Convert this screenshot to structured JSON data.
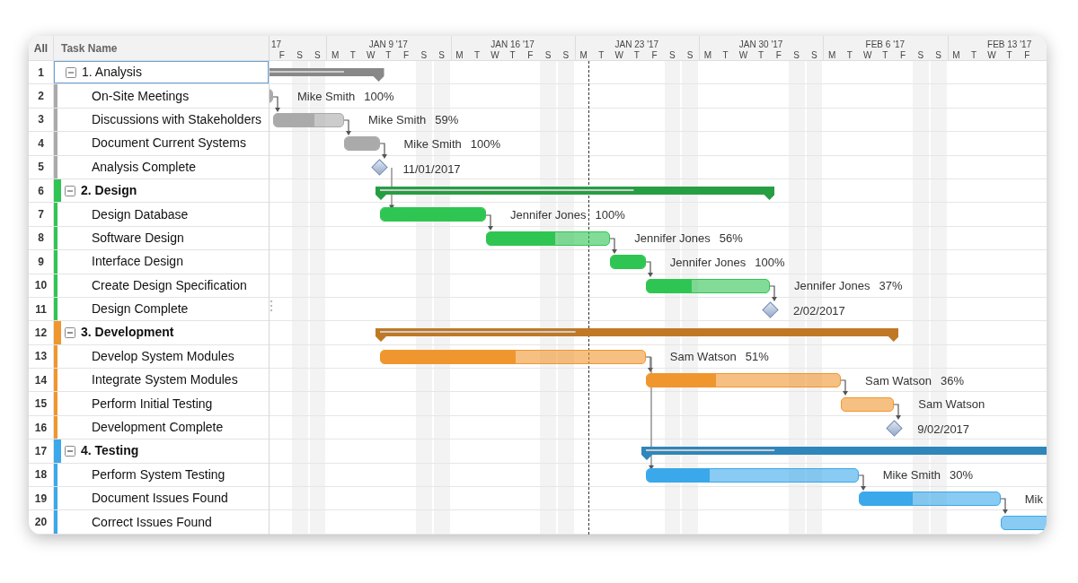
{
  "header": {
    "all_label": "All",
    "name_label": "Task Name"
  },
  "timeline": {
    "weeks": [
      {
        "label": "17",
        "days": [
          "F",
          "S",
          "S"
        ]
      },
      {
        "label": "JAN 9 '17",
        "days": [
          "M",
          "T",
          "W",
          "T",
          "F",
          "S",
          "S"
        ]
      },
      {
        "label": "JAN 16 '17",
        "days": [
          "M",
          "T",
          "W",
          "T",
          "F",
          "S",
          "S"
        ]
      },
      {
        "label": "JAN 23 '17",
        "days": [
          "M",
          "T",
          "W",
          "T",
          "F",
          "S",
          "S"
        ]
      },
      {
        "label": "JAN 30 '17",
        "days": [
          "M",
          "T",
          "W",
          "T",
          "F",
          "S",
          "S"
        ]
      },
      {
        "label": "FEB 6 '17",
        "days": [
          "M",
          "T",
          "W",
          "T",
          "F",
          "S",
          "S"
        ]
      },
      {
        "label": "FEB 13 '17",
        "days": [
          "M",
          "T",
          "W",
          "T",
          "F"
        ]
      }
    ]
  },
  "groups": [
    {
      "number": "1",
      "name": "1. Analysis",
      "color": "#aaaaaa",
      "expanded": true,
      "selected": true,
      "level": 0.8,
      "children": [
        {
          "number": "2",
          "name": "On-Site Meetings",
          "kind": "task",
          "level": 1,
          "resource": "Mike Smith",
          "percent": "100%"
        },
        {
          "number": "3",
          "name": "Discussions with Stakeholders",
          "kind": "task",
          "level": 0.59,
          "resource": "Mike Smith",
          "percent": "59%"
        },
        {
          "number": "4",
          "name": "Document Current Systems",
          "kind": "task",
          "level": 1,
          "resource": "Mike Smith",
          "percent": "100%"
        },
        {
          "number": "5",
          "name": "Analysis Complete",
          "kind": "milestone",
          "label": "11/01/2017",
          "link_to_next_group": true
        }
      ]
    },
    {
      "number": "6",
      "name": "2. Design",
      "color": "#2fc552",
      "expanded": true,
      "selected": false,
      "level": 0.65,
      "children": [
        {
          "number": "7",
          "name": "Design Database",
          "kind": "task",
          "level": 1,
          "resource": "Jennifer Jones",
          "percent": "100%"
        },
        {
          "number": "8",
          "name": "Software Design",
          "kind": "task",
          "level": 0.56,
          "resource": "Jennifer Jones",
          "percent": "56%"
        },
        {
          "number": "9",
          "name": "Interface Design",
          "kind": "task",
          "level": 1,
          "resource": "Jennifer Jones",
          "percent": "100%"
        },
        {
          "number": "10",
          "name": "Create Design Specification",
          "kind": "task",
          "level": 0.37,
          "resource": "Jennifer Jones",
          "percent": "37%"
        },
        {
          "number": "11",
          "name": "Design Complete",
          "kind": "milestone",
          "label": "2/02/2017"
        }
      ]
    },
    {
      "number": "12",
      "name": "3. Development",
      "color": "#f0962e",
      "expanded": true,
      "selected": false,
      "level": 0.38,
      "children": [
        {
          "number": "13",
          "name": "Develop System Modules",
          "kind": "task",
          "level": 0.51,
          "resource": "Sam Watson",
          "percent": "51%",
          "link_to_next_group": true
        },
        {
          "number": "14",
          "name": "Integrate System Modules",
          "kind": "task",
          "level": 0.36,
          "resource": "Sam Watson",
          "percent": "36%"
        },
        {
          "number": "15",
          "name": "Perform Initial Testing",
          "kind": "task",
          "level": 0,
          "resource": "Sam Watson"
        },
        {
          "number": "16",
          "name": "Development Complete",
          "kind": "milestone",
          "label": "9/02/2017"
        }
      ]
    },
    {
      "number": "17",
      "name": "4. Testing",
      "color": "#3aa8ea",
      "expanded": true,
      "selected": false,
      "level": 0.25,
      "children": [
        {
          "number": "18",
          "name": "Perform System Testing",
          "kind": "task",
          "level": 0.3,
          "resource": "Mike Smith",
          "percent": "30%"
        },
        {
          "number": "19",
          "name": "Document Issues Found",
          "kind": "task",
          "level": 0.38,
          "resource": "Mik"
        },
        {
          "number": "20",
          "name": "Correct Issues Found",
          "kind": "task",
          "level": 0
        }
      ]
    }
  ]
}
